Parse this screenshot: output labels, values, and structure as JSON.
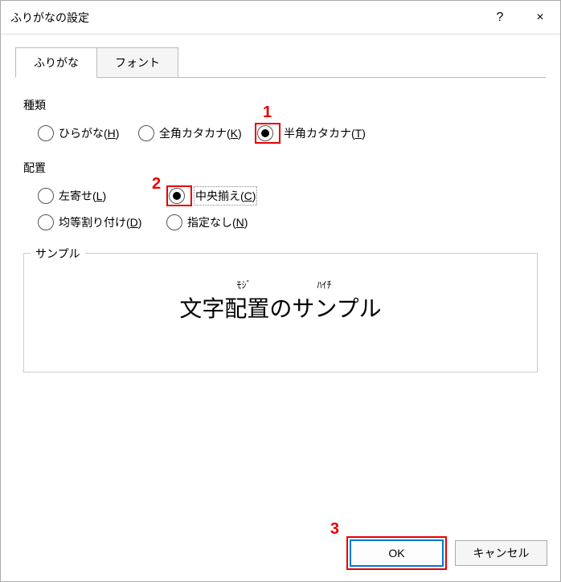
{
  "title": "ふりがなの設定",
  "titlebar": {
    "help": "?",
    "close": "×"
  },
  "tabs": {
    "furigana": "ふりがな",
    "font": "フォント"
  },
  "sections": {
    "type_label": "種類",
    "align_label": "配置"
  },
  "type_options": {
    "hiragana": {
      "label": "ひらがな(",
      "accel": "H",
      "tail": ")"
    },
    "zenkaku": {
      "label": "全角カタカナ(",
      "accel": "K",
      "tail": ")"
    },
    "hankaku": {
      "label": "半角カタカナ(",
      "accel": "T",
      "tail": ")"
    }
  },
  "align_options": {
    "left": {
      "label": "左寄せ(",
      "accel": "L",
      "tail": ")"
    },
    "center": {
      "label": "中央揃え(",
      "accel": "C",
      "tail": ")"
    },
    "dist": {
      "label": "均等割り付け(",
      "accel": "D",
      "tail": ")"
    },
    "none": {
      "label": "指定なし(",
      "accel": "N",
      "tail": ")"
    }
  },
  "sample": {
    "group_label": "サンプル",
    "ruby1": "ﾓｼﾞ",
    "ruby2": "ﾊｲﾁ",
    "main": "文字配置のサンプル"
  },
  "buttons": {
    "ok": "OK",
    "cancel": "キャンセル"
  },
  "callouts": {
    "n1": "1",
    "n2": "2",
    "n3": "3"
  }
}
